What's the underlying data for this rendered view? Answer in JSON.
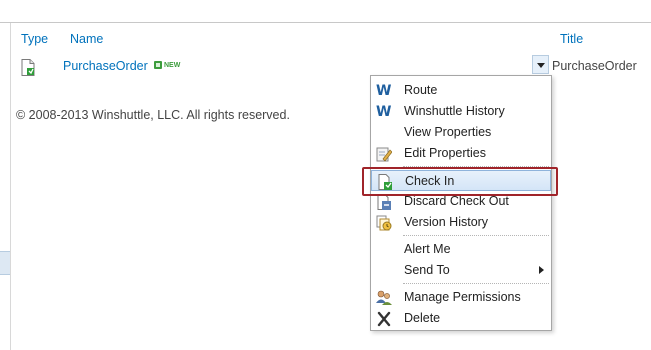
{
  "list": {
    "columns": {
      "type": "Type",
      "name": "Name",
      "title": "Title"
    },
    "rows": [
      {
        "name": "PurchaseOrder",
        "badge": "NEW",
        "title": "PurchaseOrder"
      }
    ]
  },
  "footer": {
    "copyright": "© 2008-2013 Winshuttle, LLC. All rights reserved."
  },
  "context_menu": {
    "items": [
      {
        "label": "Route",
        "icon": "winshuttle-icon"
      },
      {
        "label": "Winshuttle History",
        "icon": "winshuttle-icon"
      },
      {
        "label": "View Properties",
        "icon": "none"
      },
      {
        "label": "Edit Properties",
        "icon": "edit-properties-icon"
      },
      {
        "label": "Check In",
        "icon": "check-in-icon",
        "highlighted": true
      },
      {
        "label": "Discard Check Out",
        "icon": "discard-check-out-icon"
      },
      {
        "label": "Version History",
        "icon": "version-history-icon"
      },
      {
        "label": "Alert Me",
        "icon": "none"
      },
      {
        "label": "Send To",
        "icon": "none",
        "submenu": true
      },
      {
        "label": "Manage Permissions",
        "icon": "manage-permissions-icon"
      },
      {
        "label": "Delete",
        "icon": "delete-icon"
      }
    ]
  },
  "colors": {
    "link": "#0072bc",
    "callout": "#a0242a",
    "highlight": "#d4e5f7"
  }
}
